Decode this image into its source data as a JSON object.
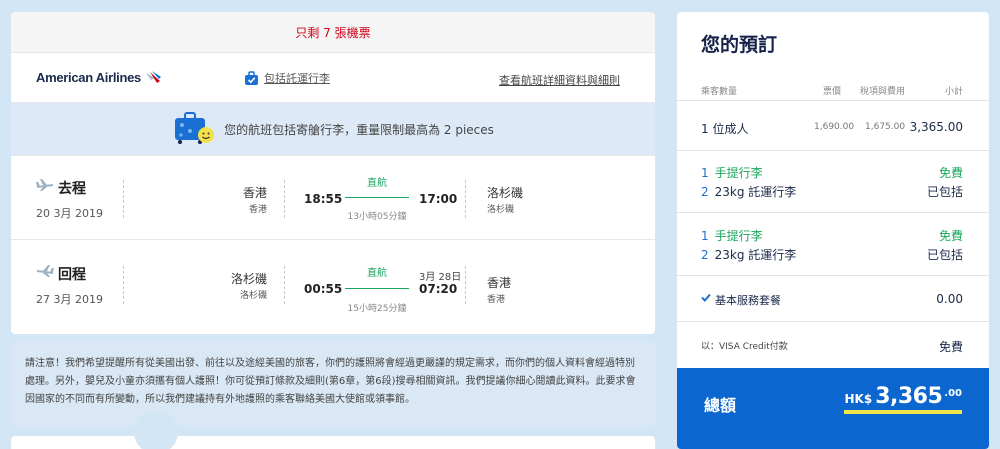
{
  "notice_bar": {
    "seats_left": "只剩 7 張機票"
  },
  "airline": {
    "name": "American Airlines",
    "bag_included": "包括託運行李",
    "details_link": "查看航班詳細資料與細則"
  },
  "baggage_banner": {
    "text": "您的航班包括寄艙行李，重量限制最高為 2 pieces"
  },
  "legs": [
    {
      "direction": "去程",
      "date": "20 3月 2019",
      "from_city": "香港",
      "from_code": "香港",
      "depart_time": "18:55",
      "nonstop": "直航",
      "duration": "13小時05分鐘",
      "arrive_time": "17:00",
      "next_day": "",
      "to_city": "洛杉磯",
      "to_code": "洛杉磯"
    },
    {
      "direction": "回程",
      "date": "27 3月 2019",
      "from_city": "洛杉磯",
      "from_code": "洛杉磯",
      "depart_time": "00:55",
      "nonstop": "直航",
      "duration": "15小時25分鐘",
      "arrive_time": "07:20",
      "next_day": "3月 28日",
      "to_city": "香港",
      "to_code": "香港"
    }
  ],
  "passport_notice": "請注意！我們希望提醒所有從美國出發、前往以及途經美國的旅客，你們的護照將會經過更嚴謹的規定需求，而你們的個人資料會經過特別處理。另外，嬰兒及小童亦須攜有個人護照！你可從預訂條款及細則(第6章，第6段)搜尋相關資訊。我們提議你細心閱讀此資料。此要求會因國家的不同而有所變動，所以我們建議持有外地護照的乘客聯絡美國大使館或領事館。",
  "booking": {
    "title": "您的預訂",
    "headers": {
      "passengers": "乘客數量",
      "fare": "票價",
      "taxes": "稅項與費用",
      "subtotal": "小計"
    },
    "passenger_row": {
      "label": "1 位成人",
      "fare": "1,690.00",
      "taxes": "1,675.00",
      "subtotal": "3,365.00"
    },
    "baggage_groups": [
      {
        "items": [
          {
            "num": "1",
            "label": "手提行李",
            "status": "免費"
          },
          {
            "num": "2",
            "label": "23kg 託運行李",
            "status": "已包括"
          }
        ]
      },
      {
        "items": [
          {
            "num": "1",
            "label": "手提行李",
            "status": "免費"
          },
          {
            "num": "2",
            "label": "23kg 託運行李",
            "status": "已包括"
          }
        ]
      }
    ],
    "service": {
      "label": "基本服務套餐",
      "price": "0.00"
    },
    "payment": {
      "label": "以：VISA Credit付款",
      "price": "免費"
    },
    "total": {
      "label": "總額",
      "currency": "HK$",
      "amount": "3,365",
      "decimals": ".00"
    }
  },
  "colors": {
    "primary": "#0b67cf",
    "green": "#1aa75c",
    "alert": "#d0021b",
    "background": "#d2e6f5"
  }
}
